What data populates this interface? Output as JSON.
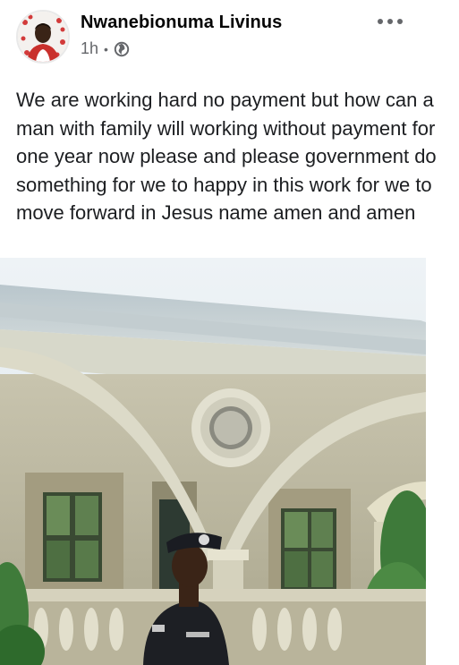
{
  "post": {
    "author": "Nwanebionuma Livinus",
    "time": "1h",
    "separator": "•",
    "audience_icon": "globe-icon",
    "more_icon": "more-options-icon",
    "text": "We are working hard no payment but how can a man with family will working without payment for one year now please and please government do something for we to happy in this work for we to move forward in Jesus name amen and amen"
  },
  "colors": {
    "name": "#050505",
    "meta": "#65676b",
    "text": "#1c1e21",
    "sky": "#dfe8ee",
    "foliage": "#3e7a3a"
  }
}
